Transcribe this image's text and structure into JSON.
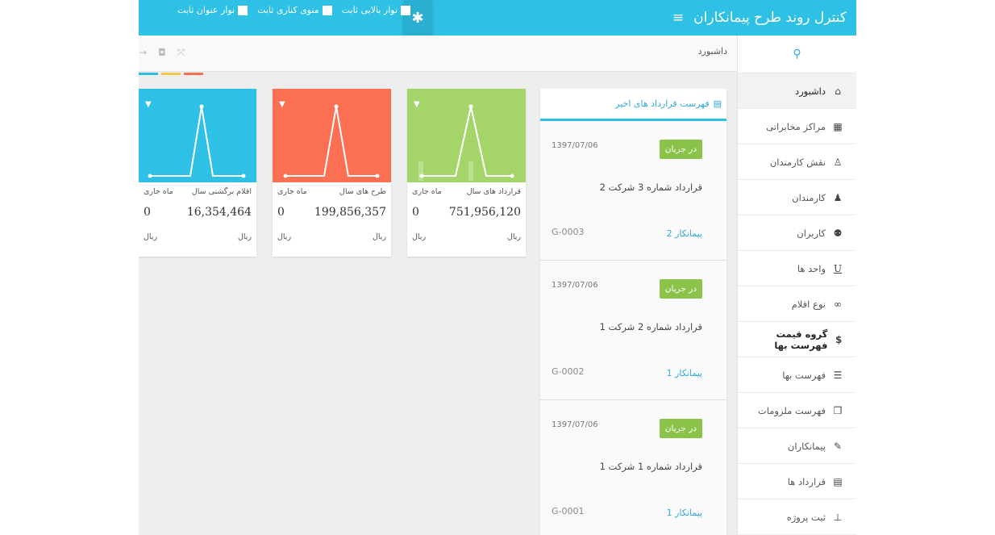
{
  "app": {
    "title": "کنترل روند طرح پیمانکاران",
    "hamburger": "≡"
  },
  "settings": {
    "opt1": "نوار بالایی ثابت",
    "opt2": "منوی کناری ثابت",
    "opt3": "نوار عنوان ثابت"
  },
  "breadcrumb": "داشبورد",
  "sidebar": {
    "items": [
      {
        "label": "داشبورد",
        "icon": "home-icon"
      },
      {
        "label": "مراکز مخابراتی",
        "icon": "grid-icon"
      },
      {
        "label": "نقش کارمندان",
        "icon": "user-tie-icon"
      },
      {
        "label": "کارمندان",
        "icon": "add-user-icon"
      },
      {
        "label": "کاربران",
        "icon": "users-icon"
      },
      {
        "label": "واحد ها",
        "icon": "underline-icon"
      },
      {
        "label": "نوع اقلام",
        "icon": "link-icon"
      },
      {
        "label": "گروه قیمت فهرست بها",
        "icon": "dollar-icon"
      },
      {
        "label": "فهرست بها",
        "icon": "list-icon"
      },
      {
        "label": "فهرست ملزومات",
        "icon": "cubes-icon"
      },
      {
        "label": "پیمانکاران",
        "icon": "edit-icon"
      },
      {
        "label": "قرارداد ها",
        "icon": "document-icon"
      },
      {
        "label": "ثبت پروژه",
        "icon": "sitemap-icon"
      }
    ]
  },
  "contracts": {
    "heading": "فهرست قرارداد های اخیر",
    "items": [
      {
        "date": "1397/07/06",
        "status": "در جریان",
        "title": "قرارداد شماره 3 شرکت 2",
        "code": "G-0003",
        "contractor": "پیمانکار 2"
      },
      {
        "date": "1397/07/06",
        "status": "در جریان",
        "title": "قرارداد شماره 2 شرکت 1",
        "code": "G-0002",
        "contractor": "پیمانکار 1"
      },
      {
        "date": "1397/07/06",
        "status": "در جریان",
        "title": "قرارداد شماره 1 شرکت 1",
        "code": "G-0001",
        "contractor": "پیمانکار 1"
      }
    ]
  },
  "cards": [
    {
      "color": "#a5d46a",
      "label_r": "قرارداد های سال",
      "label_l": "ماه جاری",
      "value_r": "751,956,120",
      "value_l": "0",
      "cur": "ریال"
    },
    {
      "color": "#fb6f53",
      "label_r": "طرح های سال",
      "label_l": "ماه جاری",
      "value_r": "199,856,357",
      "value_l": "0",
      "cur": "ریال"
    },
    {
      "color": "#2fc0e6",
      "label_r": "اقلام برگشتی سال",
      "label_l": "ماه جاری",
      "value_r": "16,354,464",
      "value_l": "0",
      "cur": "ریال"
    }
  ],
  "colors": {
    "accent": "#2fc0e6",
    "green": "#a5d46a",
    "orange": "#fb6f53",
    "yellow": "#f6c64a",
    "badge": "#8bc34a"
  }
}
